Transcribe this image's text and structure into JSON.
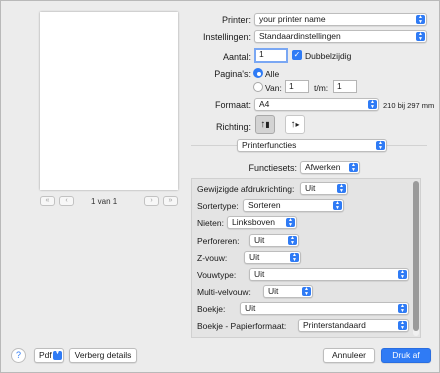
{
  "preview": {
    "page_indicator": "1 van 1",
    "first_glyph": "«",
    "prev_glyph": "‹",
    "next_glyph": "›",
    "last_glyph": "»"
  },
  "printer": {
    "label": "Printer:",
    "value": "your printer name"
  },
  "presets": {
    "label": "Instellingen:",
    "value": "Standaardinstellingen"
  },
  "copies": {
    "label": "Aantal:",
    "value": "1",
    "two_sided_label": "Dubbelzijdig",
    "two_sided_checked": true
  },
  "pages": {
    "label": "Pagina's:",
    "all_label": "Alle",
    "from_label": "Van:",
    "from_value": "1",
    "to_label": "t/m:",
    "to_value": "1"
  },
  "paper": {
    "label": "Formaat:",
    "value": "A4",
    "dimensions": "210 bij 297 mm"
  },
  "orientation": {
    "label": "Richting:",
    "portrait_glyph": "↑",
    "landscape_glyph": "↑"
  },
  "section_popup": "Printerfuncties",
  "feature_sets": {
    "label": "Functiesets:",
    "value": "Afwerken"
  },
  "features": [
    {
      "label": "Gewijzigde afdrukrichting:",
      "value": "Uit"
    },
    {
      "label": "Sortertype:",
      "value": "Sorteren"
    },
    {
      "label": "Nieten:",
      "value": "Linksboven"
    },
    {
      "label": "Perforeren:",
      "value": "Uit"
    },
    {
      "label": "Z-vouw:",
      "value": "Uit"
    },
    {
      "label": "Vouwtype:",
      "value": "Uit"
    },
    {
      "label": "Multi-velvouw:",
      "value": "Uit"
    },
    {
      "label": "Boekje:",
      "value": "Uit"
    },
    {
      "label": "Boekje - Papierformaat:",
      "value": "Printerstandaard"
    }
  ],
  "bottom": {
    "help": "?",
    "pdf": "Pdf",
    "details": "Verberg details",
    "cancel": "Annuleer",
    "print": "Druk af"
  },
  "colors": {
    "accent": "#2f7bf5",
    "panel": "#e4e4e4"
  }
}
